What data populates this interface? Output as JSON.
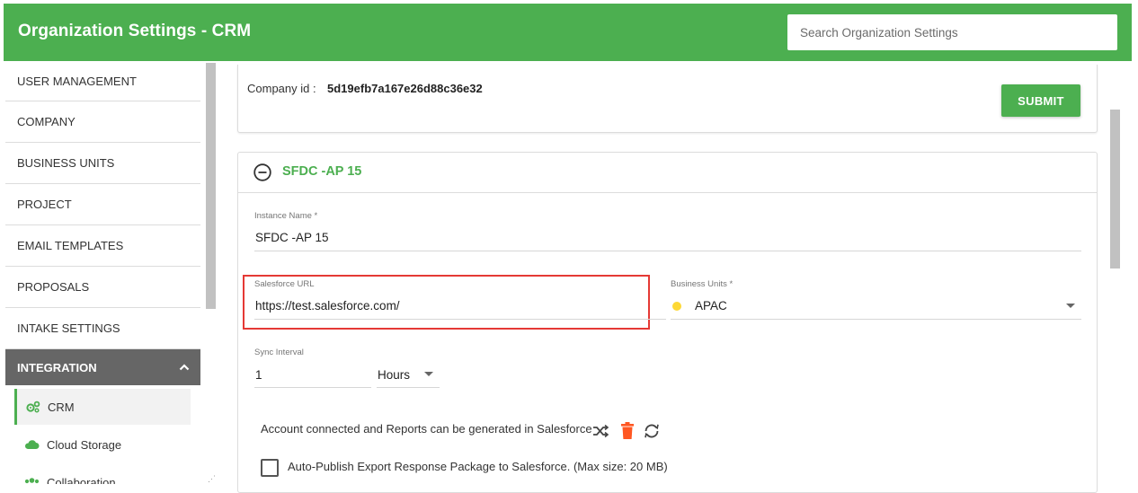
{
  "header": {
    "title": "Organization Settings - CRM",
    "search_placeholder": "Search Organization Settings"
  },
  "sidebar": {
    "items": [
      {
        "label": "USER MANAGEMENT"
      },
      {
        "label": "COMPANY"
      },
      {
        "label": "BUSINESS UNITS"
      },
      {
        "label": "PROJECT"
      },
      {
        "label": "EMAIL TEMPLATES"
      },
      {
        "label": "PROPOSALS"
      },
      {
        "label": "INTAKE SETTINGS"
      }
    ],
    "active_section": "INTEGRATION",
    "sub_items": [
      {
        "label": "CRM",
        "icon": "gears-icon"
      },
      {
        "label": "Cloud Storage",
        "icon": "cloud-icon"
      },
      {
        "label": "Collaboration",
        "icon": "users-icon"
      }
    ]
  },
  "company": {
    "label": "Company id :",
    "value": "5d19efb7a167e26d88c36e32",
    "submit_label": "SUBMIT"
  },
  "instance": {
    "title": "SFDC -AP 15",
    "name_label": "Instance Name *",
    "name_value": "SFDC -AP 15",
    "url_label": "Salesforce URL",
    "url_value": "https://test.salesforce.com/",
    "bu_label": "Business Units *",
    "bu_value": "APAC",
    "bu_dot_color": "#fdd835",
    "sync_label": "Sync Interval",
    "sync_value": "1",
    "sync_unit": "Hours",
    "status_text": "Account connected and Reports can be generated in Salesforce",
    "checkbox_label": "Auto-Publish Export Response Package to Salesforce. (Max size: 20 MB)",
    "checkbox_checked": false
  },
  "colors": {
    "brand_green": "#4caf50",
    "delete_orange": "#ff5722",
    "highlight_red": "#e53935",
    "sidebar_active": "#666666"
  }
}
